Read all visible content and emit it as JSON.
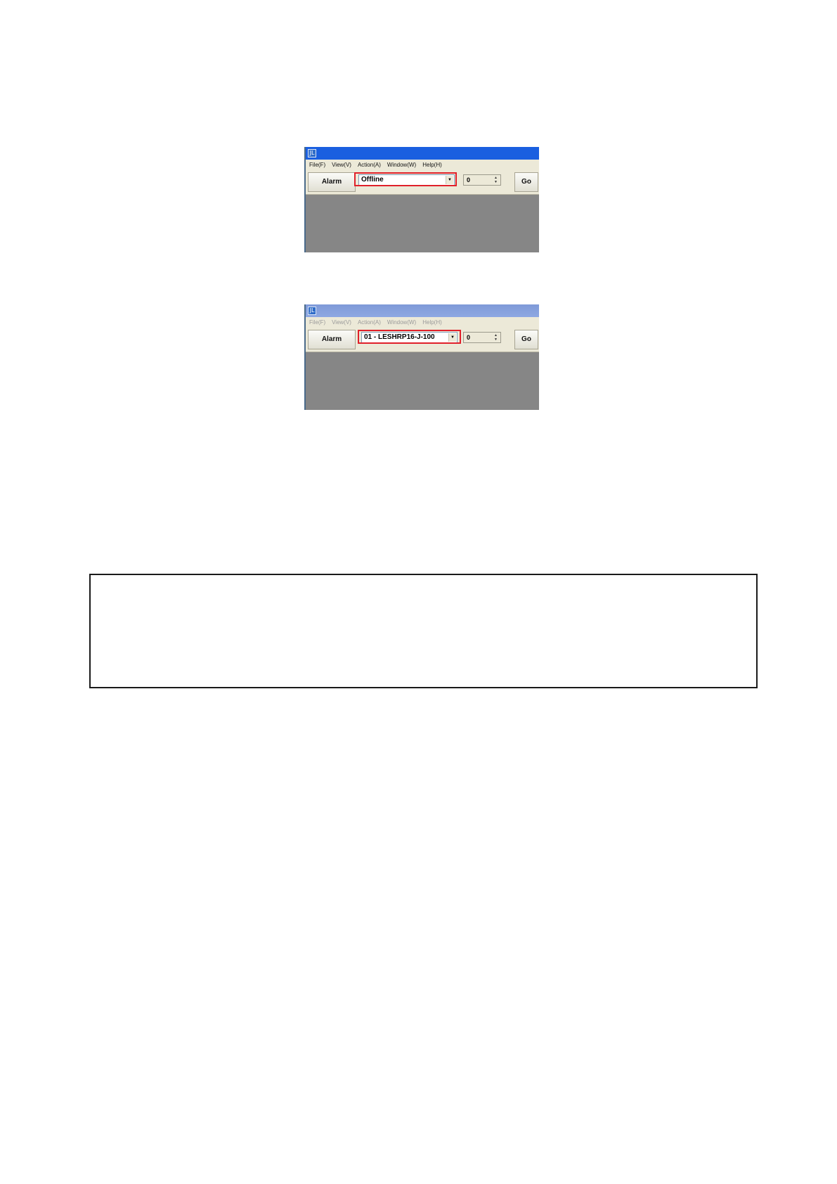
{
  "windows": [
    {
      "icon_glyph": "JL",
      "menu": [
        "File(F)",
        "View(V)",
        "Action(A)",
        "Window(W)",
        "Help(H)"
      ],
      "alarm_label": "Alarm",
      "combo_value": "Offline",
      "spin_value": "0",
      "go_label": "Go",
      "menu_enabled": true
    },
    {
      "icon_glyph": "JL",
      "menu": [
        "File(F)",
        "View(V)",
        "Action(A)",
        "Window(W)",
        "Help(H)"
      ],
      "alarm_label": "Alarm",
      "combo_value": "01 - LESHRP16-J-100",
      "spin_value": "0",
      "go_label": "Go",
      "menu_enabled": false
    }
  ],
  "colors": {
    "highlight": "#e0202a",
    "titlebar_active": "#1a5fe0",
    "client_bg": "#868686"
  }
}
